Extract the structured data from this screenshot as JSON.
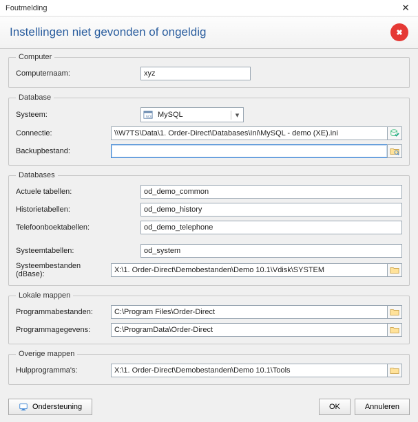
{
  "window": {
    "title": "Foutmelding"
  },
  "header": {
    "heading": "Instellingen niet gevonden of ongeldig"
  },
  "groups": {
    "computer": {
      "legend": "Computer",
      "computernaam_label": "Computernaam:",
      "computernaam_value": "xyz"
    },
    "database": {
      "legend": "Database",
      "systeem_label": "Systeem:",
      "systeem_value": "MySQL",
      "connectie_label": "Connectie:",
      "connectie_value": "\\\\W7TS\\Data\\1. Order-Direct\\Databases\\Ini\\MySQL - demo (XE).ini",
      "backup_label": "Backupbestand:",
      "backup_value": ""
    },
    "databases": {
      "legend": "Databases",
      "actuele_label": "Actuele tabellen:",
      "actuele_value": "od_demo_common",
      "historie_label": "Historietabellen:",
      "historie_value": "od_demo_history",
      "telefoon_label": "Telefoonboektabellen:",
      "telefoon_value": "od_demo_telephone",
      "systeem_label": "Systeemtabellen:",
      "systeem_value": "od_system",
      "sysbest_label": "Systeembestanden (dBase):",
      "sysbest_value": "X:\\1. Order-Direct\\Demobestanden\\Demo 10.1\\Vdisk\\SYSTEM"
    },
    "lokale": {
      "legend": "Lokale mappen",
      "prog_label": "Programmabestanden:",
      "prog_value": "C:\\Program Files\\Order-Direct",
      "data_label": "Programmagegevens:",
      "data_value": "C:\\ProgramData\\Order-Direct"
    },
    "overige": {
      "legend": "Overige mappen",
      "hulp_label": "Hulpprogramma's:",
      "hulp_value": "X:\\1. Order-Direct\\Demobestanden\\Demo 10.1\\Tools"
    }
  },
  "footer": {
    "support_label": "Ondersteuning",
    "ok_label": "OK",
    "cancel_label": "Annuleren"
  }
}
